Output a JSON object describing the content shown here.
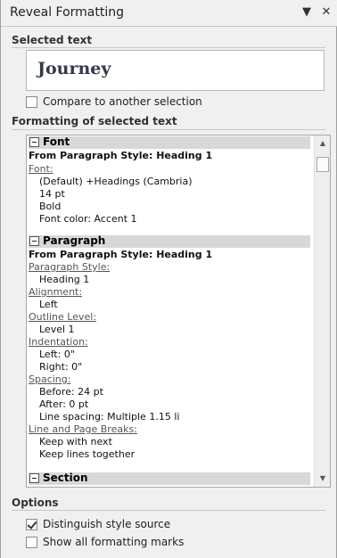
{
  "pane": {
    "title": "Reveal Formatting",
    "menu_glyph": "▼",
    "close_glyph": "✕"
  },
  "selected_section": {
    "heading": "Selected text",
    "sample_text": "Journey",
    "compare_label": "Compare to another selection",
    "compare_checked": false
  },
  "formatting_section": {
    "heading": "Formatting of selected text",
    "font_group": {
      "label": "Font",
      "source": "From Paragraph Style: Heading 1",
      "link": "Font:",
      "values": [
        "(Default) +Headings (Cambria)",
        "14 pt",
        "Bold",
        "Font color: Accent 1"
      ]
    },
    "paragraph_group": {
      "label": "Paragraph",
      "source": "From Paragraph Style: Heading 1",
      "style_link": "Paragraph Style:",
      "style_value": "Heading 1",
      "alignment_link": "Alignment:",
      "alignment_value": "Left",
      "outline_link": "Outline Level:",
      "outline_value": "Level 1",
      "indent_link": "Indentation:",
      "indent_values": [
        "Left:  0\"",
        "Right:  0\""
      ],
      "spacing_link": "Spacing:",
      "spacing_values": [
        "Before:  24 pt",
        "After:  0 pt",
        "Line spacing:  Multiple 1.15 li"
      ],
      "breaks_link": "Line and Page Breaks:",
      "breaks_values": [
        "Keep with next",
        "Keep lines together"
      ]
    },
    "section_group": {
      "label": "Section"
    }
  },
  "options_section": {
    "heading": "Options",
    "distinguish_label": "Distinguish style source",
    "distinguish_checked": true,
    "show_marks_label": "Show all formatting marks",
    "show_marks_checked": false
  }
}
